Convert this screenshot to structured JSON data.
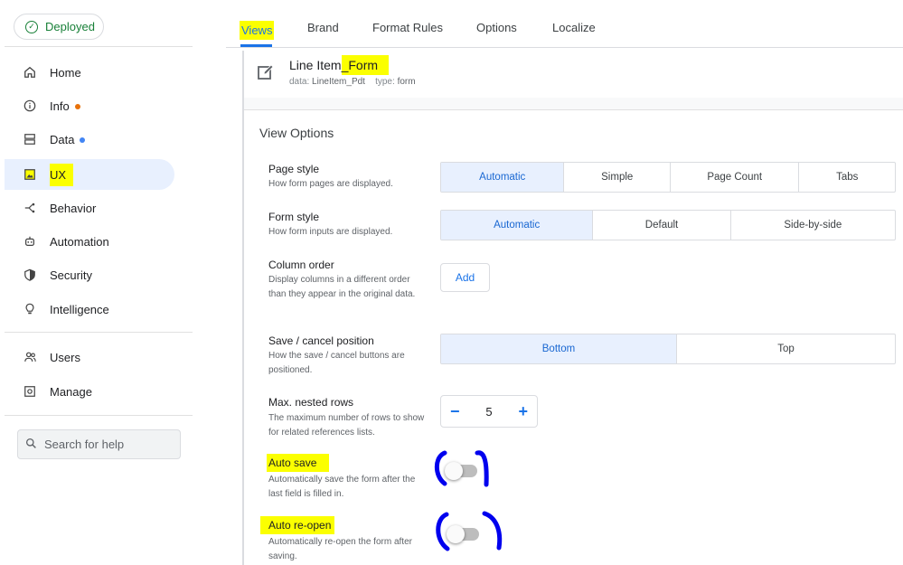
{
  "sidebar": {
    "deployed_label": "Deployed",
    "items": [
      {
        "label": "Home",
        "icon": "home-icon"
      },
      {
        "label": "Info",
        "icon": "info-icon",
        "dot": "#e8710a"
      },
      {
        "label": "Data",
        "icon": "database-icon",
        "dot": "#4285f4"
      },
      {
        "label": "UX",
        "icon": "image-icon"
      },
      {
        "label": "Behavior",
        "icon": "behavior-icon"
      },
      {
        "label": "Automation",
        "icon": "robot-icon"
      },
      {
        "label": "Security",
        "icon": "shield-icon"
      },
      {
        "label": "Intelligence",
        "icon": "lightbulb-icon"
      },
      {
        "label": "Users",
        "icon": "users-icon"
      },
      {
        "label": "Manage",
        "icon": "manage-icon"
      }
    ],
    "active_item": "UX",
    "search_placeholder": "Search for help"
  },
  "tabs": [
    {
      "label": "Views",
      "active": true
    },
    {
      "label": "Brand"
    },
    {
      "label": "Format Rules"
    },
    {
      "label": "Options"
    },
    {
      "label": "Localize"
    }
  ],
  "view": {
    "title_prefix": "Line Item",
    "title_suffix": "_Form",
    "data_key": "data:",
    "data_value": "LineItem_Pdt",
    "type_key": "type:",
    "type_value": "form"
  },
  "section_title": "View Options",
  "options": {
    "page_style": {
      "label": "Page style",
      "desc": "How form pages are displayed.",
      "choices": [
        "Automatic",
        "Simple",
        "Page Count",
        "Tabs"
      ],
      "selected": "Automatic"
    },
    "form_style": {
      "label": "Form style",
      "desc": "How form inputs are displayed.",
      "choices": [
        "Automatic",
        "Default",
        "Side-by-side"
      ],
      "selected": "Automatic"
    },
    "column_order": {
      "label": "Column order",
      "desc": "Display columns in a different order than they appear in the original data.",
      "button": "Add"
    },
    "save_cancel": {
      "label": "Save / cancel position",
      "desc": "How the save / cancel buttons are positioned.",
      "choices": [
        "Bottom",
        "Top"
      ],
      "selected": "Bottom"
    },
    "nested_rows": {
      "label": "Max. nested rows",
      "desc": "The maximum number of rows to show for related references lists.",
      "minus": "−",
      "value": "5",
      "plus": "+"
    },
    "auto_save": {
      "label": "Auto save",
      "desc": "Automatically save the form after the last field is filled in.",
      "enabled": false
    },
    "auto_reopen": {
      "label": "Auto re-open",
      "desc": "Automatically re-open the form after saving.",
      "enabled": false
    }
  },
  "colors": {
    "accent": "#1a73e8",
    "highlight": "#fbff00",
    "annotation": "#0000ee",
    "deployed_green": "#188038"
  }
}
